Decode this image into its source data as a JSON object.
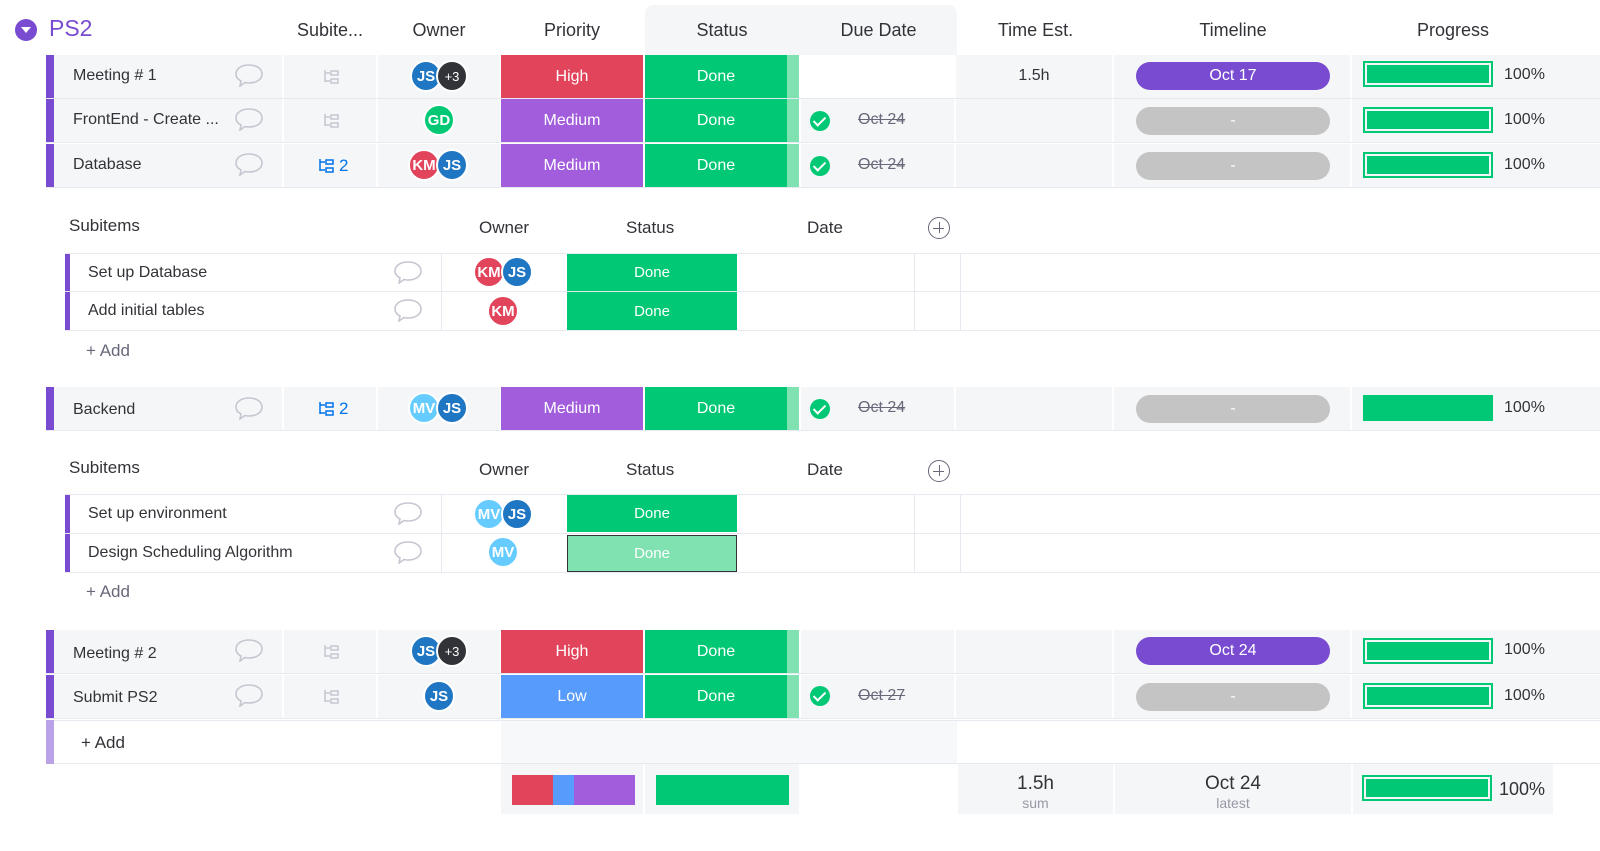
{
  "group": {
    "title": "PS2",
    "color": "#784bd1"
  },
  "columns": {
    "subitems": "Subite...",
    "owner": "Owner",
    "priority": "Priority",
    "status": "Status",
    "due_date": "Due Date",
    "time_est": "Time Est.",
    "timeline": "Timeline",
    "progress": "Progress"
  },
  "items": [
    {
      "name": "Meeting # 1",
      "subitems": "",
      "owners": [
        "JS",
        "+3"
      ],
      "priority": "High",
      "status": "Done",
      "due": "",
      "time": "1.5h",
      "timeline": "Oct 17",
      "progress": "100%"
    },
    {
      "name": "FrontEnd - Create ...",
      "subitems": "",
      "owners": [
        "GD"
      ],
      "priority": "Medium",
      "status": "Done",
      "due": "Oct 24",
      "time": "",
      "timeline": "-",
      "progress": "100%"
    },
    {
      "name": "Database",
      "subitems": "2",
      "owners": [
        "KM",
        "JS"
      ],
      "priority": "Medium",
      "status": "Done",
      "due": "Oct 24",
      "time": "",
      "timeline": "-",
      "progress": "100%"
    },
    {
      "name": "Backend",
      "subitems": "2",
      "owners": [
        "MV",
        "JS"
      ],
      "priority": "Medium",
      "status": "Done",
      "due": "Oct 24",
      "time": "",
      "timeline": "-",
      "progress": "100%"
    },
    {
      "name": "Meeting # 2",
      "subitems": "",
      "owners": [
        "JS",
        "+3"
      ],
      "priority": "High",
      "status": "Done",
      "due": "",
      "time": "",
      "timeline": "Oct 24",
      "progress": "100%"
    },
    {
      "name": "Submit PS2",
      "subitems": "",
      "owners": [
        "JS"
      ],
      "priority": "Low",
      "status": "Done",
      "due": "Oct 27",
      "time": "",
      "timeline": "-",
      "progress": "100%"
    }
  ],
  "subitems_database": {
    "headers": {
      "name": "Subitems",
      "owner": "Owner",
      "status": "Status",
      "date": "Date"
    },
    "rows": [
      {
        "name": "Set up Database",
        "owners": [
          "KM",
          "JS"
        ],
        "status": "Done"
      },
      {
        "name": "Add initial tables",
        "owners": [
          "KM"
        ],
        "status": "Done"
      }
    ],
    "add_label": "+ Add"
  },
  "subitems_backend": {
    "headers": {
      "name": "Subitems",
      "owner": "Owner",
      "status": "Status",
      "date": "Date"
    },
    "rows": [
      {
        "name": "Set up environment",
        "owners": [
          "MV",
          "JS"
        ],
        "status": "Done"
      },
      {
        "name": "Design Scheduling Algorithm",
        "owners": [
          "MV"
        ],
        "status": "Done"
      }
    ],
    "add_label": "+ Add"
  },
  "add_item_label": "+ Add",
  "summary": {
    "time_value": "1.5h",
    "time_caption": "sum",
    "timeline_value": "Oct 24",
    "timeline_caption": "latest",
    "progress": "100%",
    "priority_distribution": [
      {
        "label": "High",
        "fraction": 0.33,
        "color": "#e2445c"
      },
      {
        "label": "Low",
        "fraction": 0.17,
        "color": "#579bfc"
      },
      {
        "label": "Medium",
        "fraction": 0.5,
        "color": "#a25ddc"
      }
    ],
    "status_distribution": [
      {
        "label": "Done",
        "fraction": 1.0,
        "color": "#00c875"
      }
    ]
  },
  "colors": {
    "high": "#e2445c",
    "medium": "#a25ddc",
    "low": "#579bfc",
    "done": "#00c875",
    "done_light": "#7fe2b0",
    "timeline_active": "#784bd1",
    "timeline_empty": "#c4c4c4",
    "avatar_js": "#1f76c2",
    "avatar_km": "#e2445c",
    "avatar_gd": "#00c875",
    "avatar_mv": "#66ccff",
    "avatar_more": "#323338"
  },
  "icons": {
    "group_toggle": "chevron-down-icon",
    "update": "speech-bubble-icon",
    "subitems": "subitems-tree-icon",
    "check": "check-circle-icon",
    "add_column": "plus-circle-icon"
  }
}
